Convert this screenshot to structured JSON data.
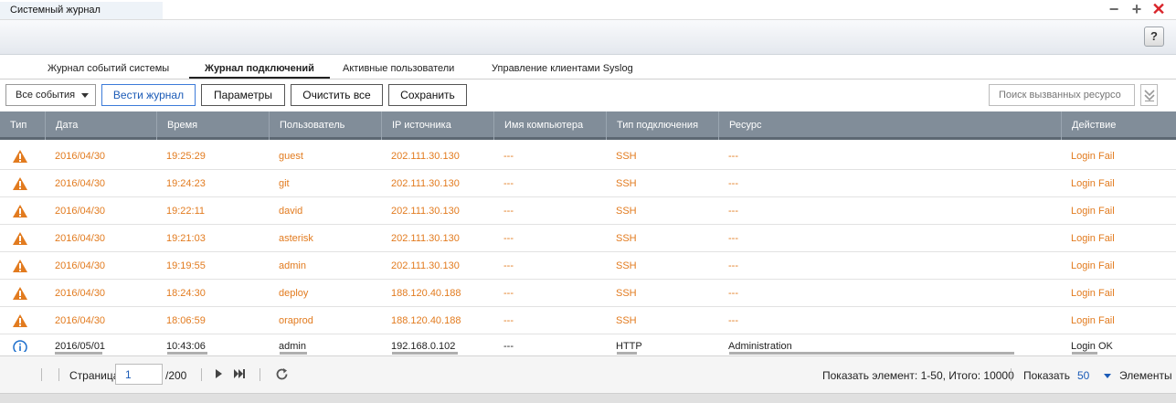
{
  "window": {
    "title": "Системный журнал",
    "minimize_symbol": "−",
    "add_symbol": "+",
    "close_symbol": "✕",
    "help_label": "?"
  },
  "tabs": [
    {
      "label": "Журнал событий системы",
      "active": false
    },
    {
      "label": "Журнал подключений",
      "active": true
    },
    {
      "label": "Активные пользователи",
      "active": false
    },
    {
      "label": "Управление клиентами Syslog",
      "active": false
    }
  ],
  "toolbar": {
    "filter_value": "Все события",
    "start_logging": "Вести журнал",
    "options": "Параметры",
    "clear_all": "Очистить все",
    "save": "Сохранить",
    "search_placeholder": "Поиск вызванных ресурсо"
  },
  "columns": [
    "Тип",
    "Дата",
    "Время",
    "Пользователь",
    "IP источника",
    "Имя компьютера",
    "Тип подключения",
    "Ресурс",
    "Действие"
  ],
  "rows": [
    {
      "type": "warning-icon",
      "date": "2016/04/30",
      "time": "19:25:29",
      "user": "guest",
      "ip": "202.111.30.130",
      "computer": "---",
      "conn": "SSH",
      "resource": "---",
      "action": "Login Fail"
    },
    {
      "type": "warning-icon",
      "date": "2016/04/30",
      "time": "19:24:23",
      "user": "git",
      "ip": "202.111.30.130",
      "computer": "---",
      "conn": "SSH",
      "resource": "---",
      "action": "Login Fail"
    },
    {
      "type": "warning-icon",
      "date": "2016/04/30",
      "time": "19:22:11",
      "user": "david",
      "ip": "202.111.30.130",
      "computer": "---",
      "conn": "SSH",
      "resource": "---",
      "action": "Login Fail"
    },
    {
      "type": "warning-icon",
      "date": "2016/04/30",
      "time": "19:21:03",
      "user": "asterisk",
      "ip": "202.111.30.130",
      "computer": "---",
      "conn": "SSH",
      "resource": "---",
      "action": "Login Fail"
    },
    {
      "type": "warning-icon",
      "date": "2016/04/30",
      "time": "19:19:55",
      "user": "admin",
      "ip": "202.111.30.130",
      "computer": "---",
      "conn": "SSH",
      "resource": "---",
      "action": "Login Fail"
    },
    {
      "type": "warning-icon",
      "date": "2016/04/30",
      "time": "18:24:30",
      "user": "deploy",
      "ip": "188.120.40.188",
      "computer": "---",
      "conn": "SSH",
      "resource": "---",
      "action": "Login Fail"
    },
    {
      "type": "warning-icon",
      "date": "2016/04/30",
      "time": "18:06:59",
      "user": "oraprod",
      "ip": "188.120.40.188",
      "computer": "---",
      "conn": "SSH",
      "resource": "---",
      "action": "Login Fail"
    },
    {
      "type": "info-icon",
      "date": "2016/05/01",
      "time": "10:43:06",
      "user": "admin",
      "ip": "192.168.0.102",
      "computer": "---",
      "conn": "HTTP",
      "resource": "Administration",
      "action": "Login OK"
    }
  ],
  "footer": {
    "page_label": "Страница",
    "page_value": "1",
    "page_total": "/200",
    "show_items": "Показать элемент: 1-50, Итого: 10000",
    "show_label": "Показать",
    "page_size": "50",
    "items_label": "Элементы"
  },
  "colors": {
    "warning": "#e27b1f",
    "info": "#1e6fcc",
    "header_bg": "#818d99",
    "accent": "#1b5bb7"
  }
}
